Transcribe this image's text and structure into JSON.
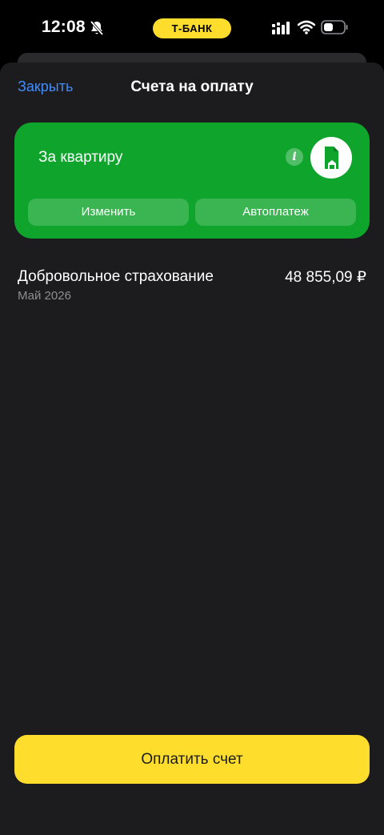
{
  "status_bar": {
    "time": "12:08",
    "brand": "Т-БАНК",
    "icons": [
      "bell-off-icon",
      "signal-icon",
      "wifi-icon",
      "battery-icon"
    ]
  },
  "header": {
    "close_label": "Закрыть",
    "title": "Счета на оплату"
  },
  "bill_card": {
    "title": "За квартиру",
    "info_icon": "info-icon",
    "category_icon": "house-document-icon",
    "edit_label": "Изменить",
    "autopay_label": "Автоплатеж"
  },
  "bills": [
    {
      "name": "Добровольное страхование",
      "amount": "48 855,09 ₽",
      "period": "Май 2026"
    }
  ],
  "pay_button": {
    "label": "Оплатить счет"
  },
  "colors": {
    "accent_yellow": "#ffdd2d",
    "card_green": "#0fa52d",
    "link_blue": "#428bf9",
    "sheet_bg": "#1c1c1e",
    "secondary_text": "#8e8e93"
  }
}
